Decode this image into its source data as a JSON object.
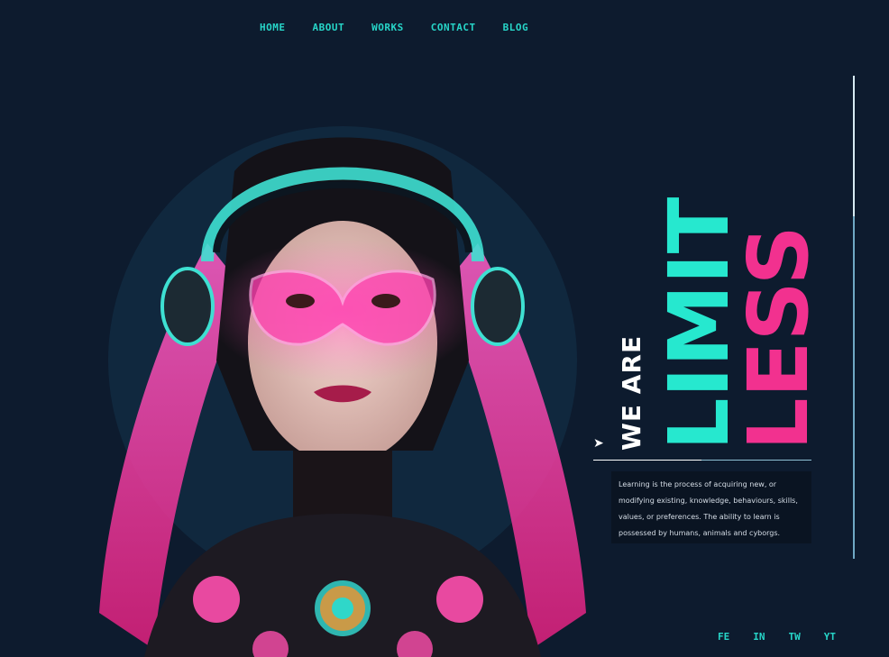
{
  "nav": {
    "items": [
      {
        "label": "HOME"
      },
      {
        "label": "ABOUT"
      },
      {
        "label": "WORKS"
      },
      {
        "label": "CONTACT"
      },
      {
        "label": "BLOG"
      }
    ]
  },
  "hero": {
    "subtitle": "WE ARE",
    "title_line1": "LIMIT",
    "title_line2": "LESS",
    "description": "Learning is the process of acquiring new, or modifying existing, knowledge, behaviours, skills, values, or preferences. The ability to learn is possessed by humans, animals and cyborgs.",
    "image": "cyborg-woman-portrait"
  },
  "social": {
    "items": [
      {
        "label": "FE"
      },
      {
        "label": "IN"
      },
      {
        "label": "TW"
      },
      {
        "label": "YT"
      }
    ]
  },
  "colors": {
    "background": "#0d1b2e",
    "accent_cyan": "#26e8cf",
    "accent_pink": "#f2318f"
  }
}
